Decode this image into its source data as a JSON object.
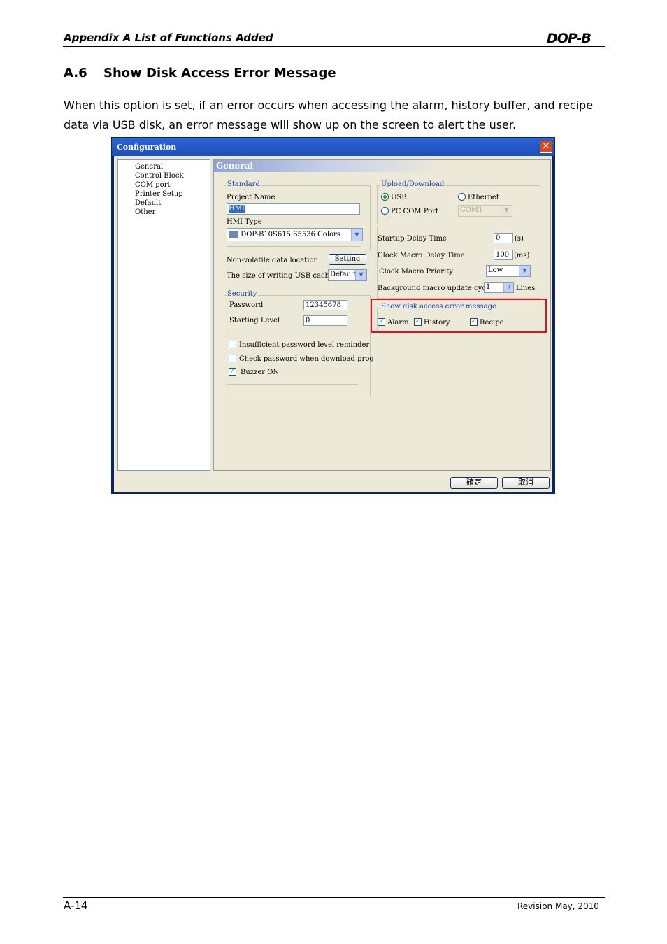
{
  "header": {
    "title": "Appendix A List of Functions Added",
    "logo": "DOP-B"
  },
  "section": {
    "number": "A.6",
    "title": "Show Disk Access Error Message"
  },
  "paragraph": "When this option is set, if an error occurs when accessing the alarm, history buffer, and recipe data via USB disk, an error message will show up on the screen to alert the user.",
  "dialog": {
    "title": "Configuration",
    "close_glyph": "✕",
    "tree": [
      "General",
      "Control Block",
      "COM port",
      "Printer Setup",
      "Default",
      "Other"
    ],
    "panel_title": "General",
    "standard": {
      "legend": "Standard",
      "project_name_label": "Project Name",
      "project_name_value": "HMI",
      "hmi_type_label": "HMI Type",
      "hmi_type_value": "DOP-B10S615 65536 Colors",
      "nonvolatile_label": "Non-volatile data location",
      "setting_button": "Setting",
      "usb_cache_label": "The size of writing USB cache",
      "usb_cache_value": "Default"
    },
    "security": {
      "legend": "Security",
      "password_label": "Password",
      "password_value": "12345678",
      "starting_level_label": "Starting Level",
      "starting_level_value": "0",
      "insufficient_label": "Insufficient password level reminder",
      "check_password_label": "Check password when download prog",
      "buzzer_label": "Buzzer ON"
    },
    "upload": {
      "legend": "Upload/Download",
      "usb_label": "USB",
      "ethernet_label": "Ethernet",
      "pc_com_label": "PC COM Port",
      "com_value": "COM1"
    },
    "timing": {
      "startup_label": "Startup Delay Time",
      "startup_value": "0",
      "startup_unit": "(s)",
      "clock_delay_label": "Clock Macro Delay Time",
      "clock_delay_value": "100",
      "clock_delay_unit": "(ms)",
      "priority_label": "Clock Macro Priority",
      "priority_value": "Low",
      "bg_cycle_label": "Background macro update cycle",
      "bg_cycle_value": "1",
      "bg_cycle_unit": "Lines"
    },
    "disk_error": {
      "legend": "Show disk access error message",
      "alarm_label": "Alarm",
      "history_label": "History",
      "recipe_label": "Recipe"
    },
    "ok_button": "確定",
    "cancel_button": "取消",
    "check_glyph": "✓",
    "dropdown_glyph": "▼",
    "spin_glyph": "⇕"
  },
  "footer": {
    "page": "A-14",
    "revision": "Revision May, 2010"
  }
}
